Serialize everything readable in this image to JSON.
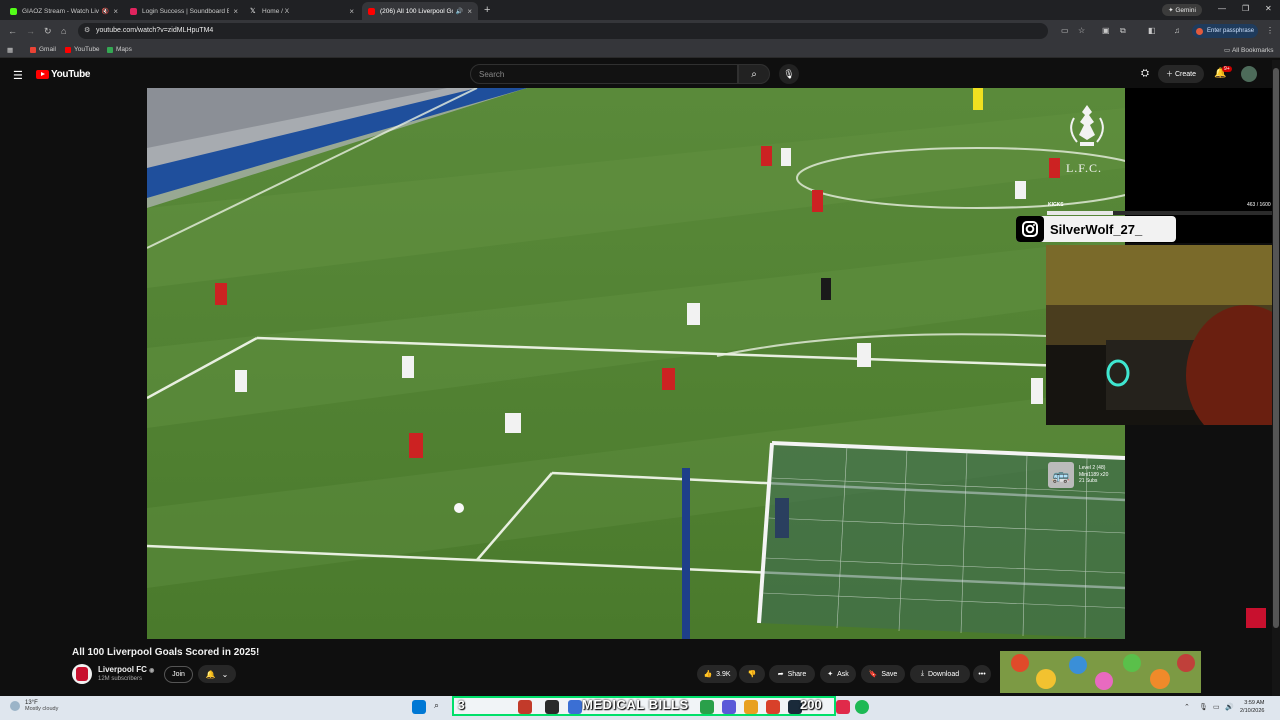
{
  "browser": {
    "tabs": [
      {
        "title": "GIAOZ Stream - Watch Livi",
        "favicon_color": "#53fc18",
        "muted": true,
        "active": false
      },
      {
        "title": "Login Success | Soundboard Bo",
        "favicon_color": "#e0245e",
        "muted": false,
        "active": false
      },
      {
        "title": "Home / X",
        "favicon_color": "#ffffff",
        "muted": false,
        "active": false
      },
      {
        "title": "(206) All 100 Liverpool Goal",
        "favicon_color": "#ff0000",
        "muted": false,
        "active": true
      }
    ],
    "gemini_label": "Gemini",
    "url": "youtube.com/watch?v=zidMLHpuTM4",
    "enter_passphrase": "Enter passphrase",
    "bookmarks": [
      {
        "label": "Gmail",
        "color": "#ea4335"
      },
      {
        "label": "YouTube",
        "color": "#ff0000"
      },
      {
        "label": "Maps",
        "color": "#34a853"
      }
    ],
    "all_bookmarks": "All Bookmarks"
  },
  "youtube": {
    "logo_text": "YouTube",
    "search_placeholder": "Search",
    "create_label": "Create",
    "notifications_badge": "9+"
  },
  "video": {
    "title": "All 100 Liverpool Goals Scored in 2025!",
    "channel": "Liverpool FC",
    "verified_mark": "◉",
    "subscribers": "12M subscribers",
    "join_label": "Join",
    "likes": "3.9K",
    "share_label": "Share",
    "ask_label": "Ask",
    "save_label": "Save",
    "download_label": "Download"
  },
  "overlay": {
    "lfc_text": "L.F.C.",
    "kicks_label": "KICKS",
    "kicks_count": "463 / 1600",
    "kicks_progress": 0.29,
    "instagram_handle": "SilverWolf_27_",
    "subgoal_line1": "Level 2 (48)",
    "subgoal_line2": "Mini1189 x20",
    "subgoal_line3": "21 Subs"
  },
  "taskbar": {
    "temperature": "13°F",
    "weather": "Mostly cloudy",
    "banner_start": "3",
    "banner_text": "MEDICAL BILLS",
    "banner_end": "200",
    "time": "3:59 AM",
    "date": "2/10/2026"
  },
  "colors": {
    "accent_red": "#ff0000",
    "lfc_red": "#c8102e",
    "banner_border": "#00e06a"
  }
}
